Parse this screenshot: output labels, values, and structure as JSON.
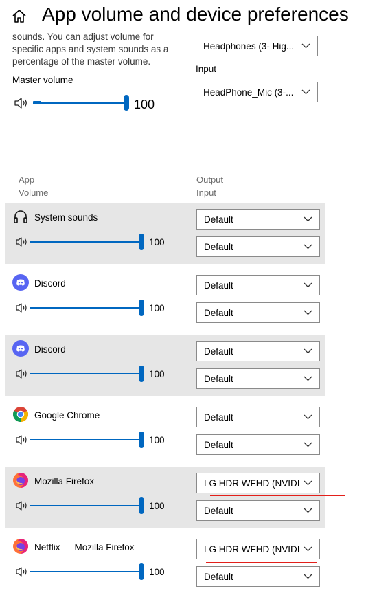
{
  "header": {
    "title": "App volume and device preferences"
  },
  "description": "sounds. You can adjust volume for specific apps and system sounds as a percentage of the master volume.",
  "master": {
    "label": "Master volume",
    "value": "100",
    "level": 1.0
  },
  "device": {
    "output_selected": "Headphones (3- Hig...",
    "input_label": "Input",
    "input_selected": "HeadPhone_Mic (3-..."
  },
  "columns": {
    "app_header": "App",
    "volume_header": "Volume",
    "output_header": "Output",
    "input_header": "Input"
  },
  "apps": [
    {
      "name": "System sounds",
      "icon": "headphones-icon",
      "volume": "100",
      "output": "Default",
      "input": "Default"
    },
    {
      "name": "Discord",
      "icon": "discord-icon",
      "volume": "100",
      "output": "Default",
      "input": "Default"
    },
    {
      "name": "Discord",
      "icon": "discord-icon",
      "volume": "100",
      "output": "Default",
      "input": "Default"
    },
    {
      "name": "Google Chrome",
      "icon": "chrome-icon",
      "volume": "100",
      "output": "Default",
      "input": "Default"
    },
    {
      "name": "Mozilla Firefox",
      "icon": "firefox-icon",
      "volume": "100",
      "output": "LG HDR WFHD (NVIDI",
      "input": "Default"
    },
    {
      "name": "Netflix — Mozilla Firefox",
      "icon": "firefox-icon",
      "volume": "100",
      "output": "LG HDR WFHD (NVIDI",
      "input": "Default"
    }
  ],
  "colors": {
    "accent": "#0067c0",
    "row_shade": "#e6e6e6",
    "annotation_red": "#e3201b",
    "discord": "#5865f2"
  }
}
